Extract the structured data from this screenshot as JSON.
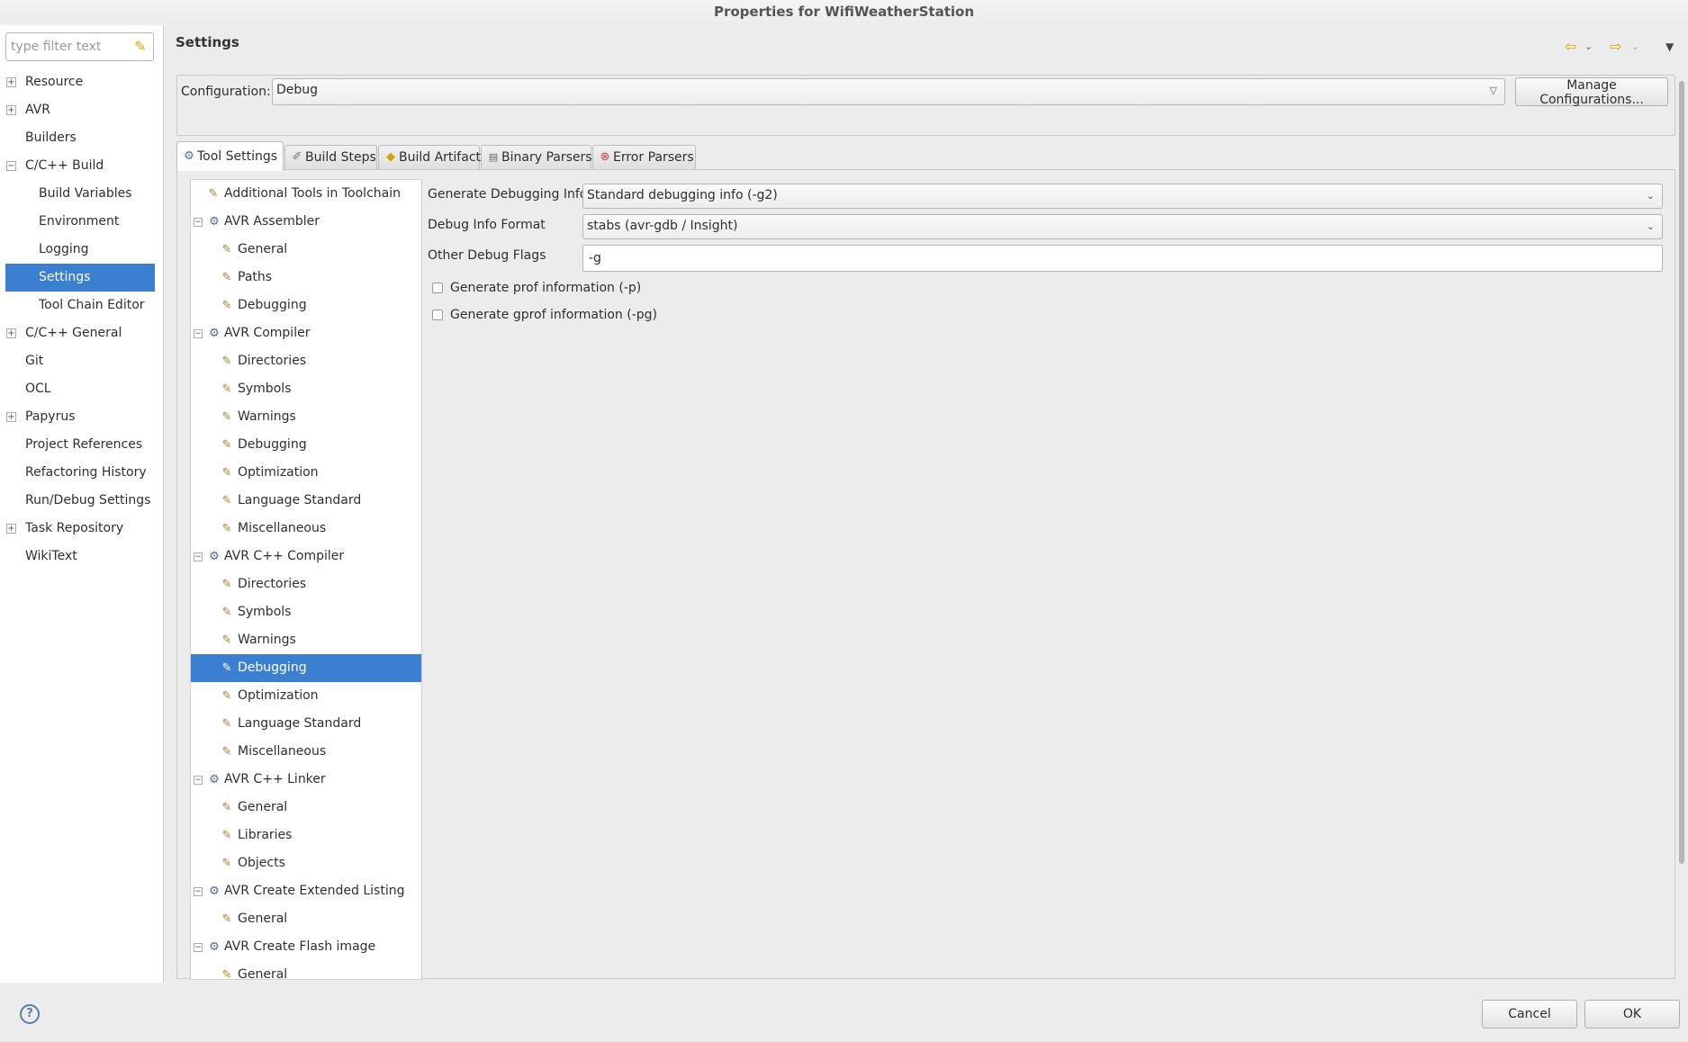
{
  "window": {
    "title": "Properties for WifiWeatherStation"
  },
  "filter": {
    "placeholder": "type filter text",
    "clear_icon": "broom-icon"
  },
  "nav": {
    "items": [
      {
        "label": "Resource",
        "expandable": true
      },
      {
        "label": "AVR",
        "expandable": true
      },
      {
        "label": "Builders",
        "expandable": false
      },
      {
        "label": "C/C++ Build",
        "expandable": true,
        "expanded": true
      },
      {
        "label": "Build Variables",
        "child": true
      },
      {
        "label": "Environment",
        "child": true
      },
      {
        "label": "Logging",
        "child": true
      },
      {
        "label": "Settings",
        "child": true,
        "selected": true
      },
      {
        "label": "Tool Chain Editor",
        "child": true
      },
      {
        "label": "C/C++ General",
        "expandable": true
      },
      {
        "label": "Git"
      },
      {
        "label": "OCL"
      },
      {
        "label": "Papyrus",
        "expandable": true
      },
      {
        "label": "Project References"
      },
      {
        "label": "Refactoring History"
      },
      {
        "label": "Run/Debug Settings"
      },
      {
        "label": "Task Repository",
        "expandable": true
      },
      {
        "label": "WikiText"
      }
    ]
  },
  "page": {
    "title": "Settings"
  },
  "configuration": {
    "label": "Configuration:",
    "value": "Debug",
    "manage_button": "Manage Configurations..."
  },
  "tabs": [
    {
      "label": "Tool Settings",
      "icon": "tool-settings-icon",
      "active": true
    },
    {
      "label": "Build Steps",
      "icon": "wrench-icon"
    },
    {
      "label": "Build Artifact",
      "icon": "artifact-icon"
    },
    {
      "label": "Binary Parsers",
      "icon": "binary-icon"
    },
    {
      "label": "Error Parsers",
      "icon": "error-icon"
    }
  ],
  "tree": [
    {
      "label": "Additional Tools in Toolchain",
      "kind": "top"
    },
    {
      "label": "AVR Assembler",
      "kind": "tool"
    },
    {
      "label": "General",
      "kind": "leaf"
    },
    {
      "label": "Paths",
      "kind": "leaf"
    },
    {
      "label": "Debugging",
      "kind": "leaf"
    },
    {
      "label": "AVR Compiler",
      "kind": "tool"
    },
    {
      "label": "Directories",
      "kind": "leaf"
    },
    {
      "label": "Symbols",
      "kind": "leaf"
    },
    {
      "label": "Warnings",
      "kind": "leaf"
    },
    {
      "label": "Debugging",
      "kind": "leaf"
    },
    {
      "label": "Optimization",
      "kind": "leaf"
    },
    {
      "label": "Language Standard",
      "kind": "leaf"
    },
    {
      "label": "Miscellaneous",
      "kind": "leaf"
    },
    {
      "label": "AVR C++ Compiler",
      "kind": "tool"
    },
    {
      "label": "Directories",
      "kind": "leaf"
    },
    {
      "label": "Symbols",
      "kind": "leaf"
    },
    {
      "label": "Warnings",
      "kind": "leaf"
    },
    {
      "label": "Debugging",
      "kind": "leaf",
      "selected": true
    },
    {
      "label": "Optimization",
      "kind": "leaf"
    },
    {
      "label": "Language Standard",
      "kind": "leaf"
    },
    {
      "label": "Miscellaneous",
      "kind": "leaf"
    },
    {
      "label": "AVR C++ Linker",
      "kind": "tool"
    },
    {
      "label": "General",
      "kind": "leaf"
    },
    {
      "label": "Libraries",
      "kind": "leaf"
    },
    {
      "label": "Objects",
      "kind": "leaf"
    },
    {
      "label": "AVR Create Extended Listing",
      "kind": "tool"
    },
    {
      "label": "General",
      "kind": "leaf"
    },
    {
      "label": "AVR Create Flash image",
      "kind": "tool"
    },
    {
      "label": "General",
      "kind": "leaf"
    }
  ],
  "form": {
    "debug_info": {
      "label": "Generate Debugging Info",
      "value": "Standard debugging info (-g2)"
    },
    "debug_format": {
      "label": "Debug Info Format",
      "value": "stabs (avr-gdb / Insight)"
    },
    "other_flags": {
      "label": "Other Debug Flags",
      "value": "-g"
    },
    "prof": {
      "label": "Generate prof information (-p)",
      "checked": false
    },
    "gprof": {
      "label": "Generate gprof information (-pg)",
      "checked": false
    }
  },
  "buttons": {
    "cancel": "Cancel",
    "ok": "OK"
  },
  "colors": {
    "selection": "#3b7fd1",
    "background": "#ececec"
  }
}
